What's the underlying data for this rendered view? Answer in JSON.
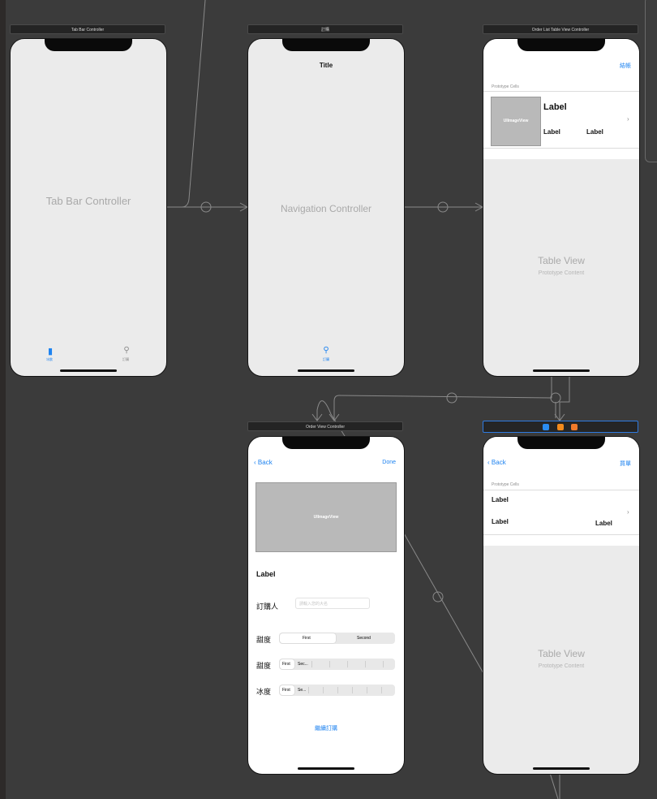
{
  "scenes": {
    "tabbar": {
      "header": "Tab Bar Controller",
      "center": "Tab Bar Controller",
      "tab1": "冰飲",
      "tab2": "訂購"
    },
    "nav": {
      "header": "訂購",
      "title": "Title",
      "center": "Navigation Controller",
      "tab": "訂購"
    },
    "orderlist": {
      "header": "Order List Table View Controller",
      "nav_right": "結帳",
      "proto": "Prototype Cells",
      "image": "UIImageView",
      "big_label": "Label",
      "label1": "Label",
      "label2": "Label",
      "tv": "Table View",
      "tv_sub": "Prototype Content"
    },
    "orderview": {
      "header": "Order View Controller",
      "back": "Back",
      "done": "Done",
      "image": "UIImageView",
      "label": "Label",
      "buyer": "訂購人",
      "placeholder": "請輸入您的大名",
      "sweet1": "甜度",
      "seg_first": "First",
      "seg_second": "Second",
      "sweet2": "甜度",
      "seg2_first": "First",
      "seg2_second": "Sec...",
      "ice": "冰度",
      "seg3_first": "First",
      "seg3_second": "Se...",
      "continue": "繼續訂購"
    },
    "detail": {
      "back": "Back",
      "nav_right": "買單",
      "proto": "Prototype Cells",
      "label1": "Label",
      "label2": "Label",
      "label3": "Label",
      "tv": "Table View",
      "tv_sub": "Prototype Content"
    }
  },
  "colors": {
    "accent": "#1e83f0",
    "canvas": "#3b3b3b"
  }
}
